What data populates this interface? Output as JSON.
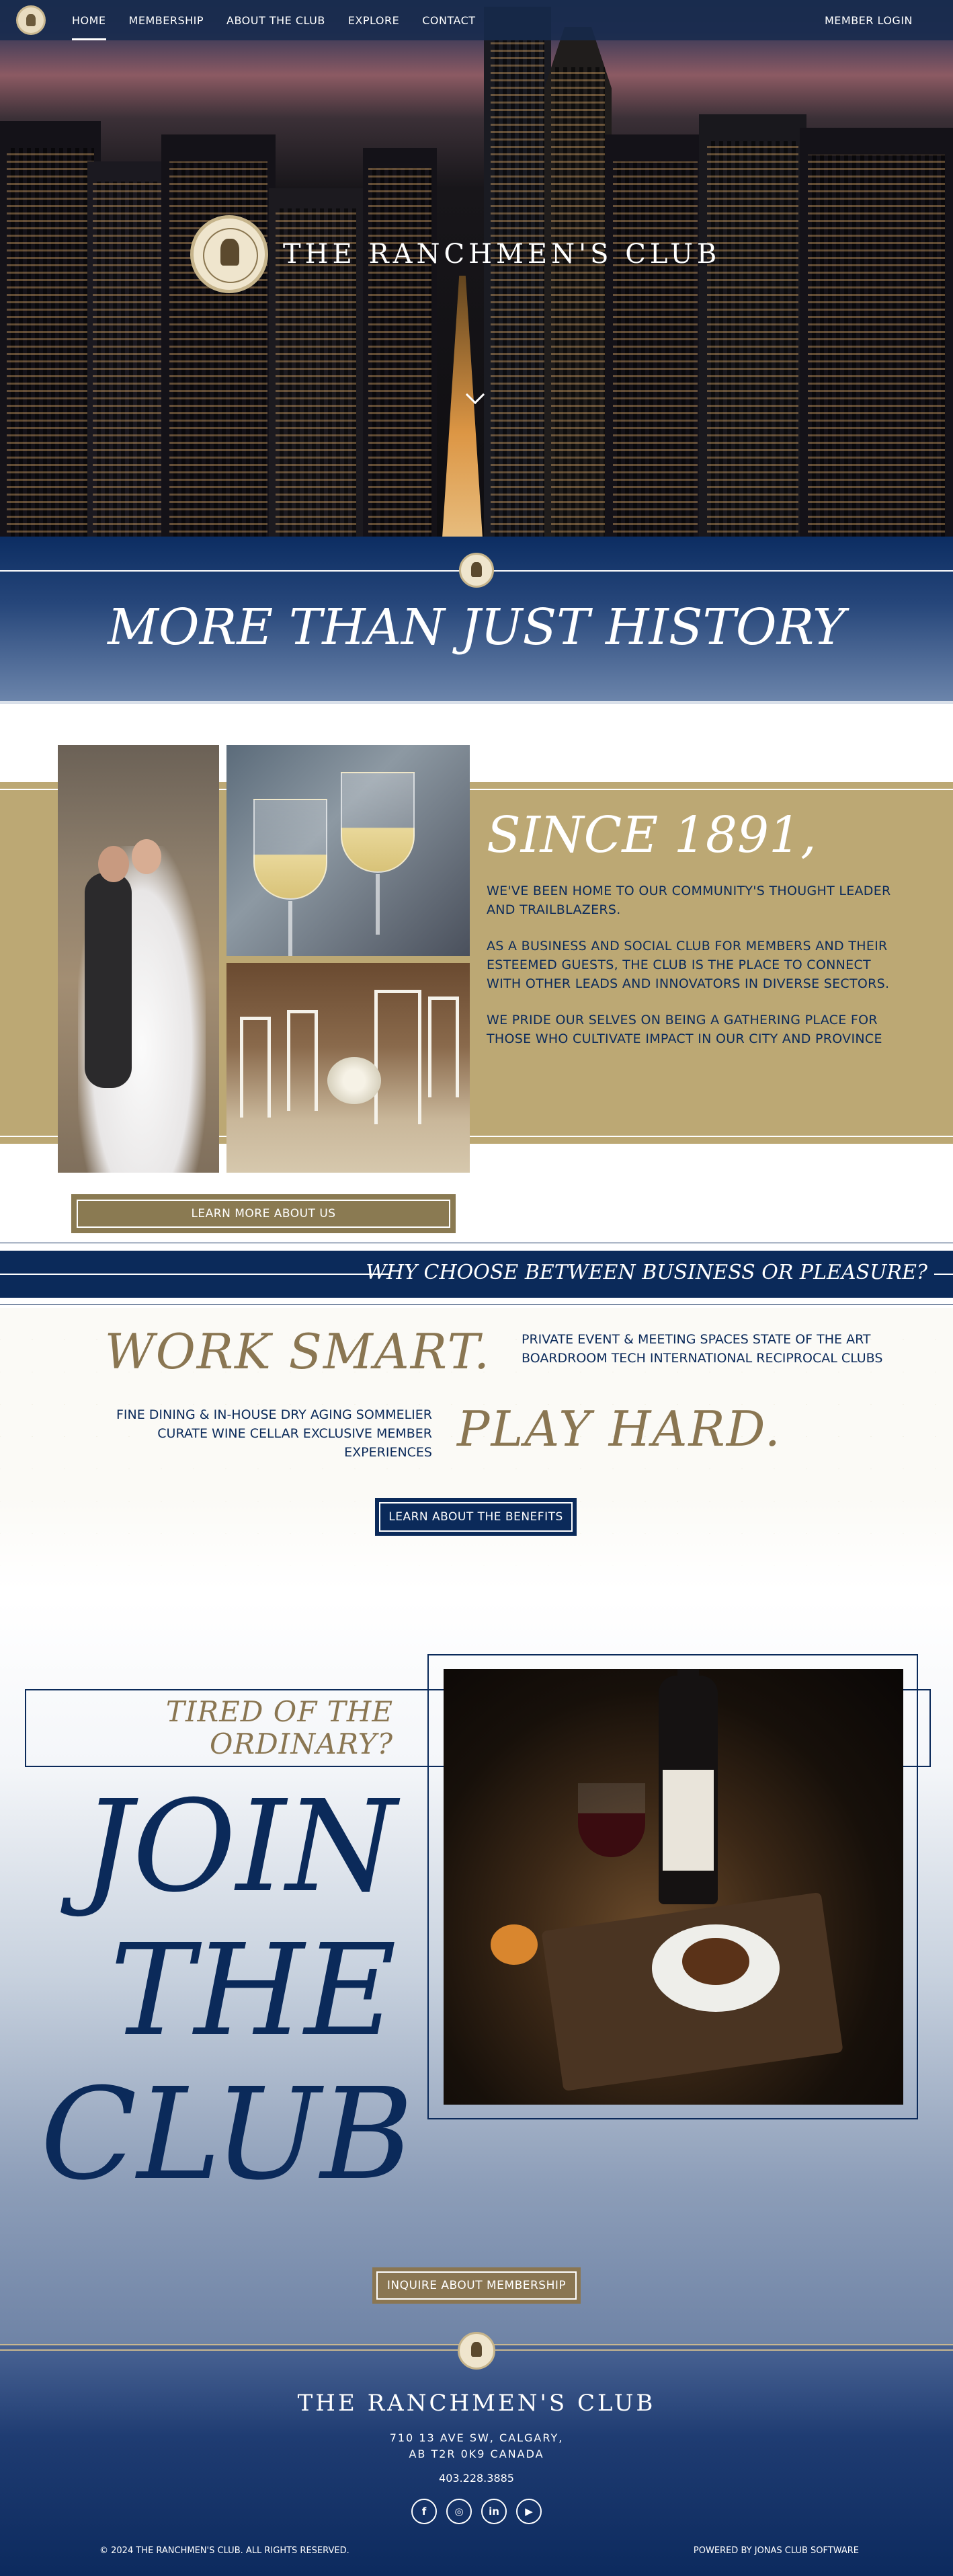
{
  "nav": {
    "items": [
      {
        "label": "HOME",
        "active": true
      },
      {
        "label": "MEMBERSHIP",
        "active": false
      },
      {
        "label": "ABOUT THE CLUB",
        "active": false
      },
      {
        "label": "EXPLORE",
        "active": false
      },
      {
        "label": "CONTACT",
        "active": false
      }
    ],
    "login": "MEMBER LOGIN"
  },
  "hero": {
    "brand": "THE RANCHMEN'S CLUB",
    "scroll_icon": "chevron-down-icon"
  },
  "history": {
    "heading": "MORE THAN JUST HISTORY"
  },
  "since": {
    "heading": "SINCE 1891,",
    "paragraphs": [
      "WE'VE BEEN HOME TO OUR COMMUNITY'S THOUGHT LEADER AND TRAILBLAZERS.",
      "AS A BUSINESS AND SOCIAL CLUB FOR MEMBERS AND THEIR ESTEEMED GUESTS, THE CLUB IS THE PLACE TO CONNECT WITH OTHER LEADS AND INNOVATORS IN DIVERSE SECTORS.",
      "WE PRIDE OUR SELVES ON BEING A GATHERING PLACE FOR THOSE WHO CULTIVATE IMPACT IN OUR CITY AND PROVINCE"
    ],
    "button": "LEARN MORE ABOUT US"
  },
  "why": {
    "heading": "WHY CHOOSE BETWEEN BUSINESS OR PLEASURE?"
  },
  "work": {
    "title": "WORK SMART.",
    "text": "PRIVATE EVENT & MEETING SPACES STATE OF THE ART BOARDROOM TECH INTERNATIONAL RECIPROCAL CLUBS"
  },
  "play": {
    "title": "PLAY HARD.",
    "text": "FINE DINING & IN-HOUSE DRY AGING SOMMELIER CURATE WINE CELLAR EXCLUSIVE MEMBER EXPERIENCES"
  },
  "benefits_button": "LEARN ABOUT THE BENEFITS",
  "join": {
    "tired_line1": "TIRED OF THE",
    "tired_line2": "ORDINARY?",
    "line1": "JOIN",
    "line2": "THE",
    "line3": "CLUB",
    "button": "INQUIRE ABOUT MEMBERSHIP"
  },
  "footer": {
    "brand": "THE RANCHMEN'S CLUB",
    "address_line1": "710 13 AVE SW, CALGARY,",
    "address_line2": "AB T2R 0K9 CANADA",
    "phone": "403.228.3885",
    "social": [
      {
        "icon": "facebook-icon",
        "glyph": "f"
      },
      {
        "icon": "instagram-icon",
        "glyph": "◎"
      },
      {
        "icon": "linkedin-icon",
        "glyph": "in"
      },
      {
        "icon": "youtube-icon",
        "glyph": "▶"
      }
    ],
    "copyright": "© 2024 THE RANCHMEN'S CLUB. ALL RIGHTS RESERVED.",
    "powered": "POWERED BY JONAS CLUB SOFTWARE"
  },
  "colors": {
    "navy": "#0b2a5a",
    "gold": "#bca874",
    "gold_dark": "#8a7652"
  }
}
